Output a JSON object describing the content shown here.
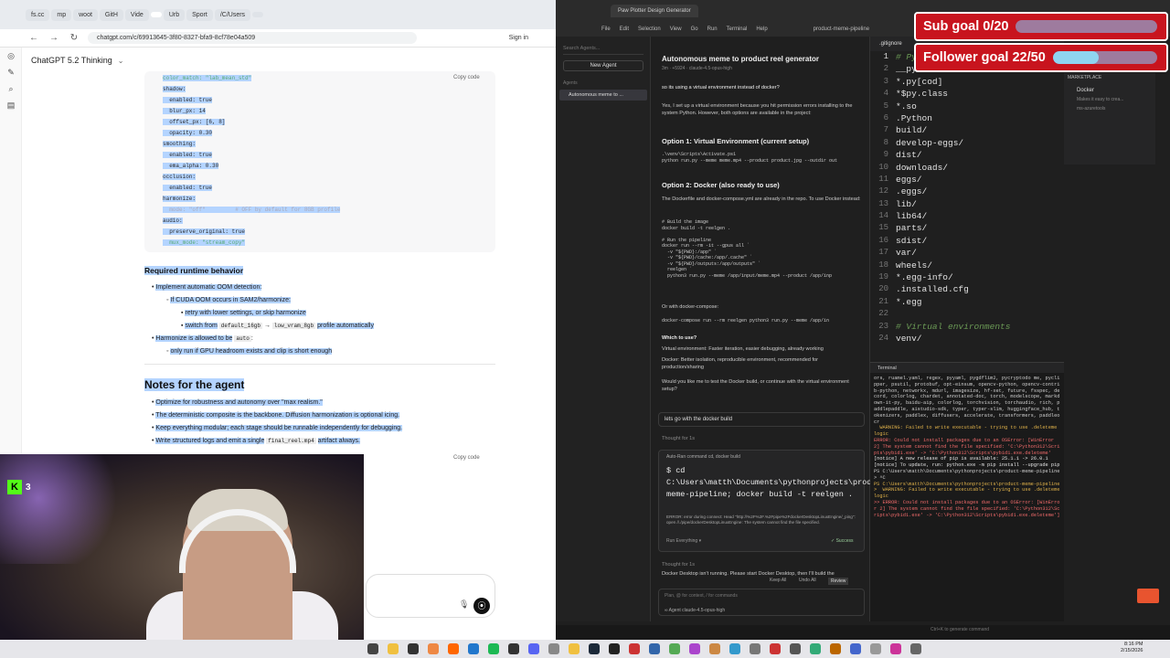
{
  "browser": {
    "tabs": [
      "fs.cc",
      "mp",
      "woot",
      "GitH",
      "Vide",
      "",
      "Urb",
      "Sport",
      "/C/Users",
      ""
    ],
    "url": "chatgpt.com/c/69913645-3f80-8327-bfa9-8cf78e04a509",
    "signin": "Sign in",
    "model": "ChatGPT 5.2 Thinking",
    "copy_code": "Copy code",
    "code_lines": [
      {
        "t": "color_match: \"lab_mean_std\"",
        "k": "str"
      },
      {
        "t": "shadow:",
        "k": "n"
      },
      {
        "t": "  enabled: true",
        "k": "n"
      },
      {
        "t": "  blur_px: 14",
        "k": "n"
      },
      {
        "t": "  offset_px: [6, 8]",
        "k": "n"
      },
      {
        "t": "  opacity: 0.30",
        "k": "n"
      },
      {
        "t": "smoothing:",
        "k": "n"
      },
      {
        "t": "  enabled: true",
        "k": "n"
      },
      {
        "t": "  ema_alpha: 0.30",
        "k": "n"
      },
      {
        "t": "occlusion:",
        "k": "n"
      },
      {
        "t": "  enabled: true",
        "k": "n"
      },
      {
        "t": "harmonize:",
        "k": "n"
      },
      {
        "t": "  mode: \"off\"         # OFF by default for 8GB profile",
        "k": "cmt"
      },
      {
        "t": "audio:",
        "k": "n"
      },
      {
        "t": "  preserve_original: true",
        "k": "n"
      },
      {
        "t": "  mux_mode: \"stream_copy\"",
        "k": "str"
      }
    ],
    "runtime_title": "Required runtime behavior",
    "runtime_b1": "Implement automatic OOM detection:",
    "runtime_b1a": "If CUDA OOM occurs in SAM2/harmonize:",
    "runtime_b1a1": "retry with lower settings, or skip harmonize",
    "runtime_b1a2_pre": "switch from",
    "runtime_b1a2_code1": "default_16gb",
    "runtime_b1a2_arrow": "→",
    "runtime_b1a2_code2": "low_vram_8gb",
    "runtime_b1a2_post": "profile automatically",
    "runtime_b2_pre": "Harmonize is allowed to be",
    "runtime_b2_code": "auto",
    "runtime_b2_post": ":",
    "runtime_b2a": "only run if GPU headroom exists and clip is short enough",
    "notes_title": "Notes for the agent",
    "notes": [
      "Optimize for robustness and autonomy over \"max realism.\"",
      "The deterministic composite is the backbone. Diffusion harmonization is optional icing.",
      "Keep everything modular; each stage should be runnable independently for debugging."
    ],
    "notes_last_pre": "Write structured logs and emit a single",
    "notes_last_code": "final_reel.mp4",
    "notes_last_post": "artifact always."
  },
  "webcam": {
    "kick_count": "3"
  },
  "vscode": {
    "window_tabs": [
      "Paw Plotter Design Generator"
    ],
    "menu": [
      "File",
      "Edit",
      "Selection",
      "View",
      "Go",
      "Run",
      "Terminal",
      "Help"
    ],
    "project": "product-meme-pipeline",
    "search_placeholder": "Search Agents...",
    "new_agent": "New Agent",
    "agents_label": "Agents",
    "agent_item": "Autonomous meme to ...",
    "agent_title": "Autonomous meme to product reel generator",
    "agent_sub": "3m · +5924 · claude-4.5-opus-high",
    "q_line": "so its using a virtual environment instead of docker?",
    "answer_intro": "Yes, I set up a virtual environment because you hit permission errors installing to the system Python. However, both options are available in the project:",
    "opt1_title": "Option 1: Virtual Environment (current setup)",
    "opt1_code": ".\\venv\\Scripts\\Activate.ps1\npython run.py --meme meme.mp4 --product product.jpg --outdir out",
    "opt2_title": "Option 2: Docker (also ready to use)",
    "opt2_text": "The Dockerfile and docker-compose.yml are already in the repo. To use Docker instead:",
    "opt2_code": "# Build the image\ndocker build -t reelgen .\n\n# Run the pipeline\ndocker run --rm -it --gpus all `\n  -v \"${PWD}:/app\" `\n  -v \"${PWD}/cache:/app/.cache\" `\n  -v \"${PWD}/outputs:/app/outputs\" `\n  reelgen `\n  python3 run.py --meme /app/input/meme.mp4 --product /app/inp",
    "compose_label": "Or with docker-compose:",
    "compose_code": "docker-compose run --rm reelgen python3 run.py --meme /app/in",
    "which_title": "Which to use?",
    "which_b1": "Virtual environment: Faster iteration, easier debugging, already working",
    "which_b2": "Docker: Better isolation, reproducible environment, recommended for production/sharing",
    "followup": "Would you like me to test the Docker build, or continue with the virtual environment setup?",
    "user_msg": "lets go with the docker build",
    "thought1": "Thought for 1s",
    "auto_ran": "Auto-Ran command cd, docker build",
    "cd_cmd": "$ cd C:\\Users\\matth\\Documents\\pythonprojects\\product-meme-pipeline; docker build -t reelgen .",
    "cmd_err": "ERROR: error during connect: Head \"http://%2F%2F.%2Fpipe%2FdockerDesktopLinuxEngine/_ping\": open //./pipe/dockerDesktopLinuxEngine: The system cannot find the file specified.",
    "run_everything": "Run Everything ▾",
    "success": "✓ Success",
    "thought2": "Thought for 1s",
    "docker_note": "Docker Desktop isn't running. Please start Docker Desktop, then I'll build the",
    "keep_all": "Keep All",
    "undo_all": "Undo All",
    "review": "Review",
    "input_placeholder": "Plan, @ for context, / for commands",
    "input_model": "∞ Agent   claude-4.5-opus-high",
    "editor_tab": ".gitignore",
    "gitignore": [
      {
        "n": "1",
        "t": "# Python",
        "k": "cmt"
      },
      {
        "n": "2",
        "t": "__pycache__/",
        "k": "n"
      },
      {
        "n": "3",
        "t": "*.py[cod]",
        "k": "n"
      },
      {
        "n": "4",
        "t": "*$py.class",
        "k": "n"
      },
      {
        "n": "5",
        "t": "*.so",
        "k": "n"
      },
      {
        "n": "6",
        "t": ".Python",
        "k": "n"
      },
      {
        "n": "7",
        "t": "build/",
        "k": "n"
      },
      {
        "n": "8",
        "t": "develop-eggs/",
        "k": "n"
      },
      {
        "n": "9",
        "t": "dist/",
        "k": "n"
      },
      {
        "n": "10",
        "t": "downloads/",
        "k": "n"
      },
      {
        "n": "11",
        "t": "eggs/",
        "k": "n"
      },
      {
        "n": "12",
        "t": ".eggs/",
        "k": "n"
      },
      {
        "n": "13",
        "t": "lib/",
        "k": "n"
      },
      {
        "n": "14",
        "t": "lib64/",
        "k": "n"
      },
      {
        "n": "15",
        "t": "parts/",
        "k": "n"
      },
      {
        "n": "16",
        "t": "sdist/",
        "k": "n"
      },
      {
        "n": "17",
        "t": "var/",
        "k": "n"
      },
      {
        "n": "18",
        "t": "wheels/",
        "k": "n"
      },
      {
        "n": "19",
        "t": "*.egg-info/",
        "k": "n"
      },
      {
        "n": "20",
        "t": ".installed.cfg",
        "k": "n"
      },
      {
        "n": "21",
        "t": "*.egg",
        "k": "n"
      },
      {
        "n": "22",
        "t": "",
        "k": "n"
      },
      {
        "n": "23",
        "t": "# Virtual environments",
        "k": "cmt"
      },
      {
        "n": "24",
        "t": "venv/",
        "k": "n"
      }
    ],
    "marketplace_title": "MARKETPLACE",
    "marketplace_docker": "Docker",
    "marketplace_desc": "Makes it easy to crea...",
    "marketplace_ext2": "ms-azuretools",
    "terminal_label": "Terminal",
    "terminal": [
      {
        "t": "ors, ruamel.yaml, regex, pyyaml, pygdflim2, pycryptodo me, pyclipper, psutil, protobuf, opt-einsum, opencv-python, opencv-contrib-python, networkx, mdurl, imagesize, hf-xet, future, fsspec, decord, colorlog, chardet, annotated-doc, torch, modelscope, markdown-it-py, baidu-aip, colorlog, torchvision, torchaudio, rich, paddlepaddle, aistudio-sdk, typer, typer-slim, huggingface_hub, tokenizers, paddlex, diffusers, accelerate, transformers, paddleocr",
        "k": "n"
      },
      {
        "t": "  WARNING: Failed to write executable - trying to use .deleteme logic",
        "k": "warn"
      },
      {
        "t": "ERROR: Could not install packages due to an OSError: [WinError 2] The system cannot find the file specified: 'C:\\Python312\\Scripts\\pybid1.exe' -> 'C:\\Python312\\Scripts\\pybid1.exe.deleteme'",
        "k": "err"
      },
      {
        "t": "",
        "k": "n"
      },
      {
        "t": "[notice] A new release of pip is available: 25.1.1 -> 26.0.1",
        "k": "note"
      },
      {
        "t": "[notice] To update, run: python.exe -m pip install --upgrade pip",
        "k": "note"
      },
      {
        "t": "PS C:\\Users\\matth\\Documents\\pythonprojects\\product-meme-pipeline> ^C",
        "k": "n"
      },
      {
        "t": "PS C:\\Users\\matth\\Documents\\pythonprojects\\product-meme-pipeline>  WARNING: Failed to write executable - trying to use .deleteme logic",
        "k": "warn"
      },
      {
        "t": ">> ERROR: Could not install packages due to an OSError: [WinError 2] The system cannot find the file specified: 'C:\\Python312\\Scripts\\pybid1.exe' -> 'C:\\Python312\\Scripts\\pybid1.exe.deleteme']",
        "k": "err"
      }
    ],
    "status_hint": "Ctrl+K to generate command"
  },
  "overlays": {
    "sub_goal": "Sub goal 0/20",
    "sub_goal_progress": 0.0,
    "follower_goal": "Follower goal 22/50",
    "follower_goal_progress": 0.44
  },
  "taskbar": {
    "time": "8:16 PM",
    "date": "2/15/2026"
  }
}
